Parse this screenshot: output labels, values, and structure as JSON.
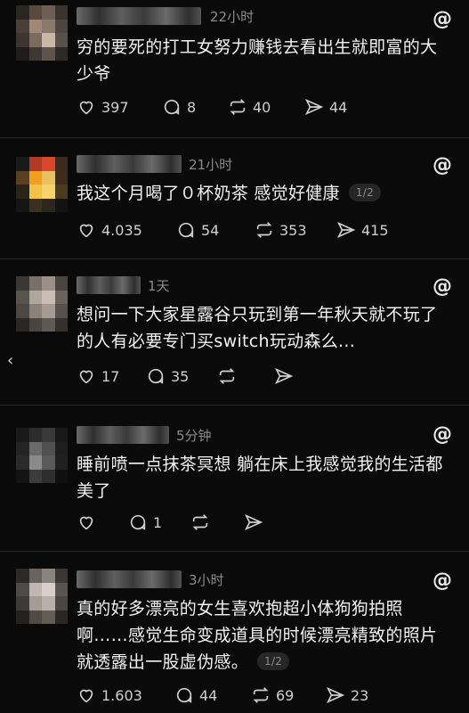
{
  "icons": {
    "like": "heart-icon",
    "reply": "comment-icon",
    "repost": "repost-icon",
    "share": "send-icon",
    "brand": "threads-logo-icon",
    "left_nav": "chevron-left-icon"
  },
  "posts": [
    {
      "time": "22小时",
      "text": "穷的要死的打工女努力赚钱去看出生就即富的大少爷",
      "page_indicator": "",
      "stats": {
        "likes": "397",
        "replies": "8",
        "reposts": "40",
        "shares": "44"
      }
    },
    {
      "time": "21小时",
      "text": "我这个月喝了０杯奶茶 感觉好健康",
      "page_indicator": "1/2",
      "stats": {
        "likes": "4.035",
        "replies": "54",
        "reposts": "353",
        "shares": "415"
      }
    },
    {
      "time": "1天",
      "text": "想问一下大家星露谷只玩到第一年秋天就不玩了的人有必要专门买switch玩动森么...",
      "page_indicator": "",
      "stats": {
        "likes": "17",
        "replies": "35",
        "reposts": "",
        "shares": ""
      }
    },
    {
      "time": "5分钟",
      "text": "睡前喷一点抹茶冥想 躺在床上我感觉我的生活都美了",
      "page_indicator": "",
      "stats": {
        "likes": "",
        "replies": "1",
        "reposts": "",
        "shares": ""
      }
    },
    {
      "time": "3小时",
      "text": "真的好多漂亮的女生喜欢抱超小体狗狗拍照啊……感觉生命变成道具的时候漂亮精致的照片就透露出一股虚伪感。",
      "page_indicator": "1/2",
      "stats": {
        "likes": "1.603",
        "replies": "44",
        "reposts": "69",
        "shares": "23"
      }
    }
  ]
}
